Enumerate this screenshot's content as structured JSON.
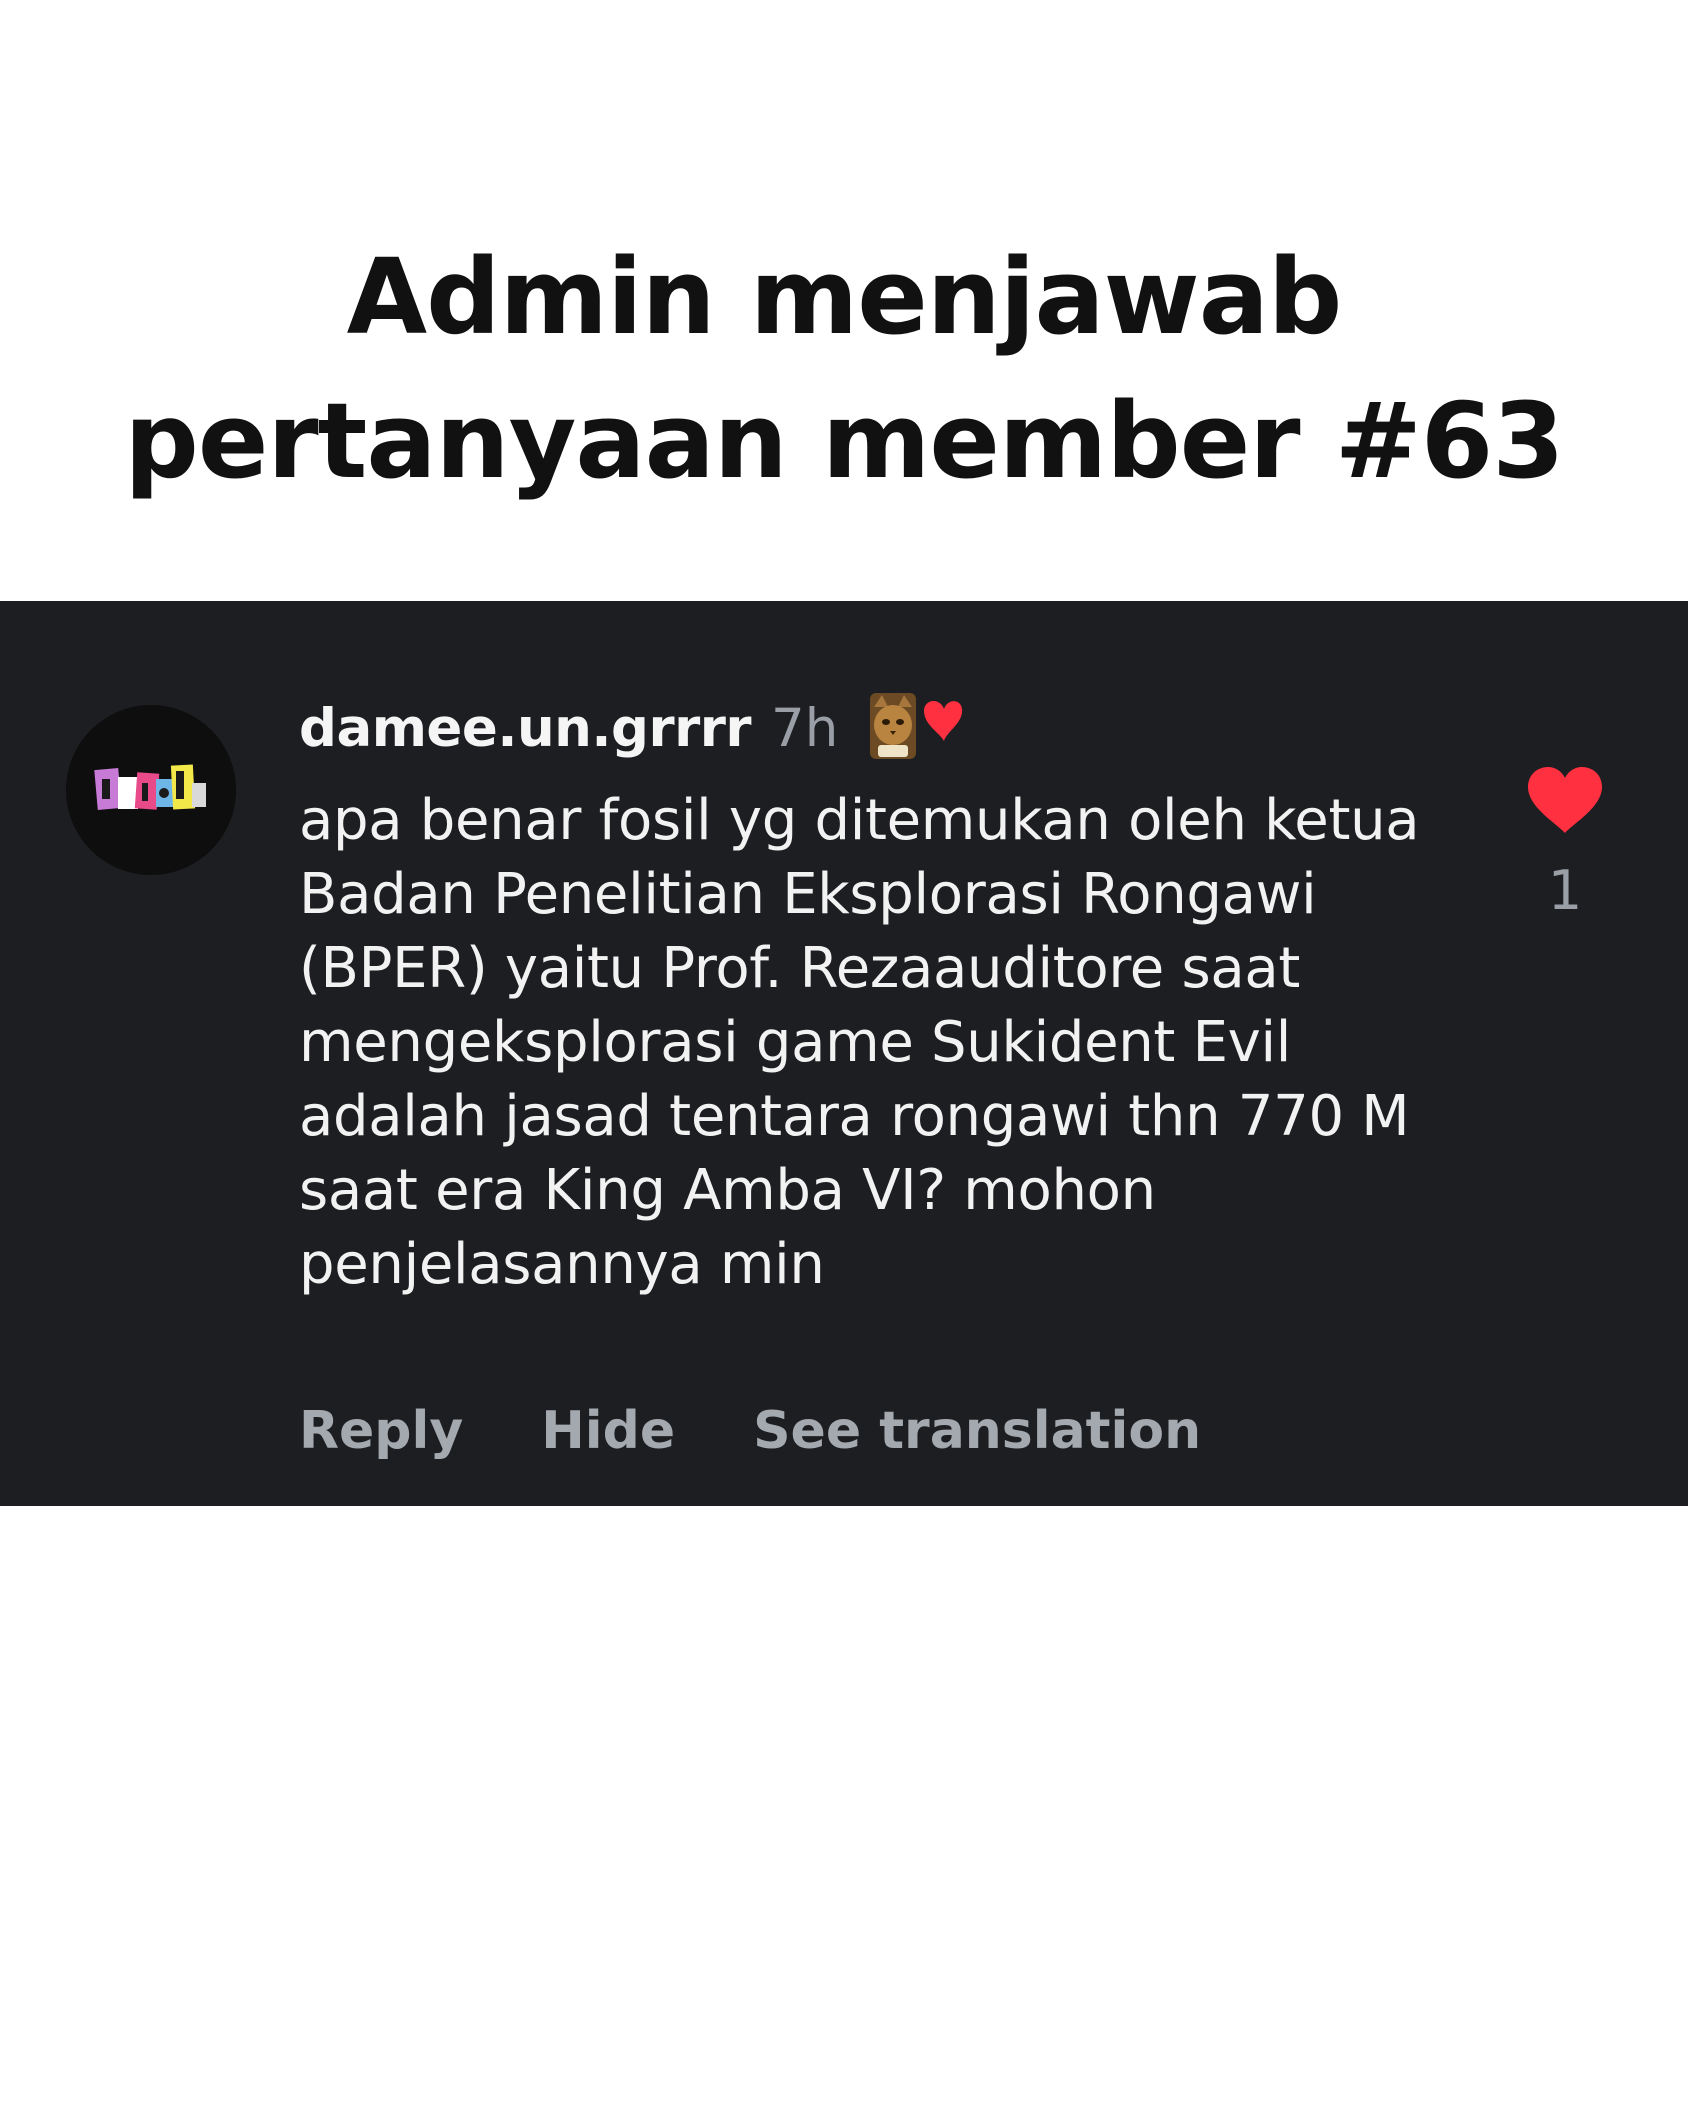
{
  "headline": {
    "line1": "Admin menjawab",
    "line2": "pertanyaan member #63"
  },
  "comment": {
    "username": "damee.un.grrrr",
    "timestamp": "7h",
    "creator_badge_icon": "cat-with-heart-icon",
    "body": "apa benar fosil yg ditemukan oleh ketua Badan Penelitian Eksplorasi Rongawi (BPER) yaitu Prof. Rezaauditore saat mengeksplorasi game Sukident Evil adalah jasad tentara rongawi thn 770 M saat era King Amba VI? mohon penjelasannya min",
    "like_count": "1",
    "actions": {
      "reply": "Reply",
      "hide": "Hide",
      "see_translation": "See translation"
    }
  },
  "colors": {
    "panel_background": "#1c1e21",
    "heart": "#ff3040",
    "secondary_text": "#9a9ea6"
  }
}
